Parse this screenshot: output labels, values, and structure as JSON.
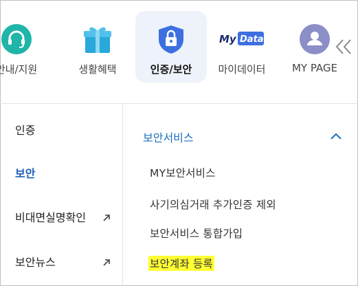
{
  "top_nav": {
    "items": [
      {
        "label": "안내/지원",
        "icon": "headset-icon"
      },
      {
        "label": "생활혜택",
        "icon": "gift-icon"
      },
      {
        "label": "인증/보안",
        "icon": "shield-lock-icon"
      },
      {
        "label": "마이데이터",
        "icon": "mydata-logo-icon"
      },
      {
        "label": "MY PAGE",
        "icon": "user-avatar-icon"
      }
    ],
    "mydata_logo": {
      "my": "My",
      "data": "Data"
    },
    "collapse_icon": "double-chevron-left-icon"
  },
  "left_menu": {
    "items": [
      {
        "label": "인증"
      },
      {
        "label": "보안"
      },
      {
        "label": "비대면실명확인",
        "external_icon": "external-arrow-icon"
      },
      {
        "label": "보안뉴스",
        "external_icon": "external-arrow-icon"
      }
    ]
  },
  "right_panel": {
    "section_title": "보안서비스",
    "toggle_icon": "chevron-up-icon",
    "items": [
      {
        "label": "MY보안서비스"
      },
      {
        "label": "사기의심거래 추가인증 제외"
      },
      {
        "label": "보안서비스 통합가입"
      },
      {
        "label": "보안계좌 등록"
      }
    ]
  },
  "colors": {
    "accent_blue": "#1c6fc0",
    "active_blue": "#1c5fb8",
    "highlight": "#ffff33",
    "active_tile_bg": "#eef2fa",
    "teal": "#1fb5a8",
    "shield_blue": "#3d6fe0",
    "avatar_purple": "#8b8ec7"
  }
}
